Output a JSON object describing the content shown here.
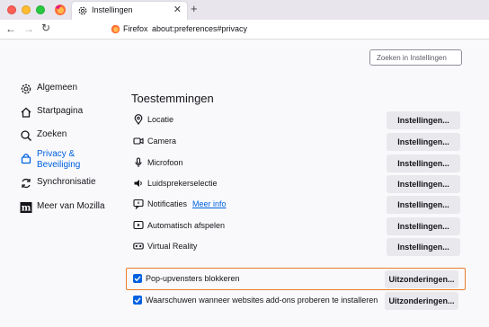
{
  "window": {
    "tab_title": "Instellingen",
    "tab_close": "✕",
    "new_tab": "+"
  },
  "navbar": {
    "back": "←",
    "forward": "→",
    "reload": "↻",
    "identity": "Firefox",
    "url": "about:preferences#privacy"
  },
  "search": {
    "placeholder": "Zoeken in Instellingen"
  },
  "sidebar": {
    "items": [
      {
        "label": "Algemeen",
        "icon": "gear-icon"
      },
      {
        "label": "Startpagina",
        "icon": "home-icon"
      },
      {
        "label": "Zoeken",
        "icon": "search-icon"
      },
      {
        "label": "Privacy & Beveiliging",
        "icon": "lock-icon",
        "active": true
      },
      {
        "label": "Synchronisatie",
        "icon": "sync-icon"
      },
      {
        "label": "Meer van Mozilla",
        "icon": "mozilla-icon"
      }
    ]
  },
  "main": {
    "heading": "Toestemmingen",
    "permissions": [
      {
        "label": "Locatie",
        "icon": "location-icon",
        "button": "Instellingen..."
      },
      {
        "label": "Camera",
        "icon": "camera-icon",
        "button": "Instellingen..."
      },
      {
        "label": "Microfoon",
        "icon": "microphone-icon",
        "button": "Instellingen..."
      },
      {
        "label": "Luidsprekerselectie",
        "icon": "speaker-icon",
        "button": "Instellingen..."
      },
      {
        "label": "Notificaties",
        "icon": "notification-icon",
        "link": "Meer info",
        "button": "Instellingen..."
      },
      {
        "label": "Automatisch afspelen",
        "icon": "autoplay-icon",
        "button": "Instellingen..."
      },
      {
        "label": "Virtual Reality",
        "icon": "vr-icon",
        "button": "Instellingen..."
      }
    ],
    "popups": {
      "label": "Pop-upvensters blokkeren",
      "checked": true,
      "button": "Uitzonderingen..."
    },
    "addons": {
      "label": "Waarschuwen wanneer websites add-ons proberen te installeren",
      "checked": true,
      "button": "Uitzonderingen..."
    }
  },
  "colors": {
    "accent": "#0061e0",
    "highlight": "#e97f2a"
  }
}
